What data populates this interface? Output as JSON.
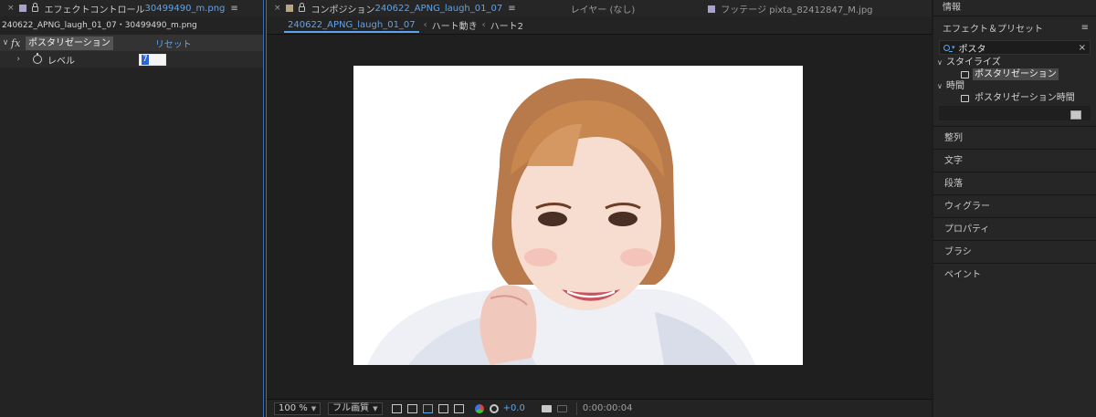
{
  "left_panel": {
    "tab_close": "×",
    "tab_title": "エフェクトコントロール",
    "tab_file": "30499490_m.png",
    "menu_icon": "≡",
    "breadcrumb": "240622_APNG_laugh_01_07・30499490_m.png",
    "effect": {
      "fx_label": "fx",
      "name": "ポスタリゼーション",
      "reset_label": "リセット",
      "property_name": "レベル",
      "property_value": "7"
    }
  },
  "center_panel": {
    "tab_close": "×",
    "comp_tab_label": "コンポジション",
    "comp_tab_name": "240622_APNG_laugh_01_07",
    "menu_icon": "≡",
    "layer_tab": "レイヤー (なし)",
    "footage_tab": "フッテージ pixta_82412847_M.jpg",
    "sub_tabs": [
      "240622_APNG_laugh_01_07",
      "ハート動き",
      "ハート2"
    ],
    "bottom": {
      "zoom": "100 %",
      "resolution": "フル画質",
      "exposure": "+0.0",
      "timecode": "0:00:00:04"
    }
  },
  "right_panel": {
    "info_title": "情報",
    "effects_title": "エフェクト＆プリセット",
    "menu_icon": "≡",
    "search_value": "ポスタ",
    "search_clear": "×",
    "tree": [
      {
        "category": "スタイライズ",
        "item": "ポスタリゼーション"
      },
      {
        "category": "時間",
        "item": "ポスタリゼーション時間"
      }
    ],
    "sections": [
      "整列",
      "文字",
      "段落",
      "ウィグラー",
      "プロパティ",
      "ブラシ",
      "ペイント"
    ]
  },
  "colors": {
    "accent_blue": "#5da4ee",
    "panel_bg": "#232323",
    "tab_square_effect": "#a6a2c8",
    "tab_square_comp": "#b9a486",
    "tab_square_footage": "#a6a2c8"
  }
}
